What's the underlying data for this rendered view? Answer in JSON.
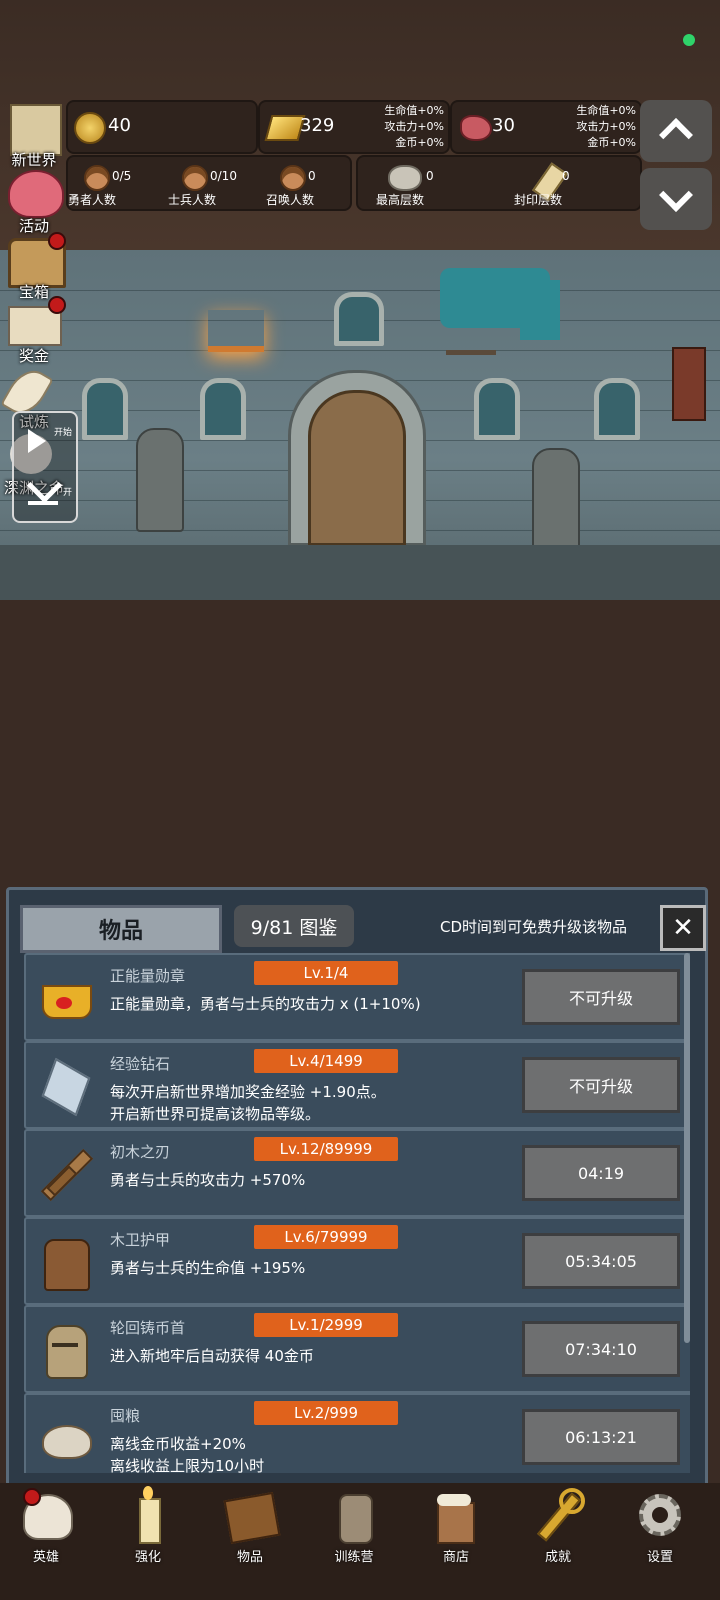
{
  "resources": {
    "gold": "40",
    "gold_bars": "329",
    "gold_bars_bonus": [
      "生命值+0%",
      "攻击力+0%",
      "金币+0%"
    ],
    "gems": "30",
    "gems_bonus": [
      "生命值+0%",
      "攻击力+0%",
      "金币+0%"
    ]
  },
  "counts": {
    "hero": {
      "value": "0/5",
      "label": "勇者人数"
    },
    "soldier": {
      "value": "0/10",
      "label": "士兵人数"
    },
    "summon": {
      "value": "0",
      "label": "召唤人数"
    },
    "highest": {
      "value": "0",
      "label": "最高层数"
    },
    "sealed": {
      "value": "0",
      "label": "封印层数"
    }
  },
  "side_menu": [
    {
      "label": "新世界",
      "icon": "map-scroll-icon"
    },
    {
      "label": "活动",
      "icon": "heart-icon"
    },
    {
      "label": "宝箱",
      "icon": "treasure-chest-icon"
    },
    {
      "label": "奖金",
      "icon": "envelope-icon"
    },
    {
      "label": "试炼",
      "icon": "feather-icon"
    },
    {
      "label": "深渊之命",
      "icon": "abyss-icon"
    }
  ],
  "video_box": {
    "label_top": "开始",
    "label_bottom": "开"
  },
  "items_panel": {
    "title": "物品",
    "collection": "9/81 图鉴",
    "cd_hint": "CD时间到可免费升级该物品",
    "items": [
      {
        "name": "正能量勋章",
        "level": "Lv.1/4",
        "desc": "正能量勋章，勇者与士兵的攻击力 x (1+10%)",
        "button": "不可升级",
        "icon": "crown-medal-icon"
      },
      {
        "name": "经验钻石",
        "level": "Lv.4/1499",
        "desc": "每次开启新世界增加奖金经验 +1.90点。\n开启新世界可提高该物品等级。",
        "button": "不可升级",
        "icon": "diamond-icon"
      },
      {
        "name": "初木之刃",
        "level": "Lv.12/89999",
        "desc": "勇者与士兵的攻击力 +570%",
        "button": "04:19",
        "icon": "wooden-sword-icon"
      },
      {
        "name": "木卫护甲",
        "level": "Lv.6/79999",
        "desc": "勇者与士兵的生命值 +195%",
        "button": "05:34:05",
        "icon": "armor-icon"
      },
      {
        "name": "轮回铸币首",
        "level": "Lv.1/2999",
        "desc": "进入新地牢后自动获得 40金币",
        "button": "07:34:10",
        "icon": "helmet-icon"
      },
      {
        "name": "囤粮",
        "level": "Lv.2/999",
        "desc": "离线金币收益+20%\n离线收益上限为10小时",
        "button": "06:13:21",
        "icon": "rice-bowl-icon"
      }
    ]
  },
  "bottom_nav": [
    {
      "label": "英雄",
      "icon": "skull-icon"
    },
    {
      "label": "强化",
      "icon": "candle-icon"
    },
    {
      "label": "物品",
      "icon": "book-icon"
    },
    {
      "label": "训练营",
      "icon": "lantern-icon"
    },
    {
      "label": "商店",
      "icon": "beer-mug-icon"
    },
    {
      "label": "成就",
      "icon": "key-icon"
    },
    {
      "label": "设置",
      "icon": "gear-icon"
    }
  ]
}
